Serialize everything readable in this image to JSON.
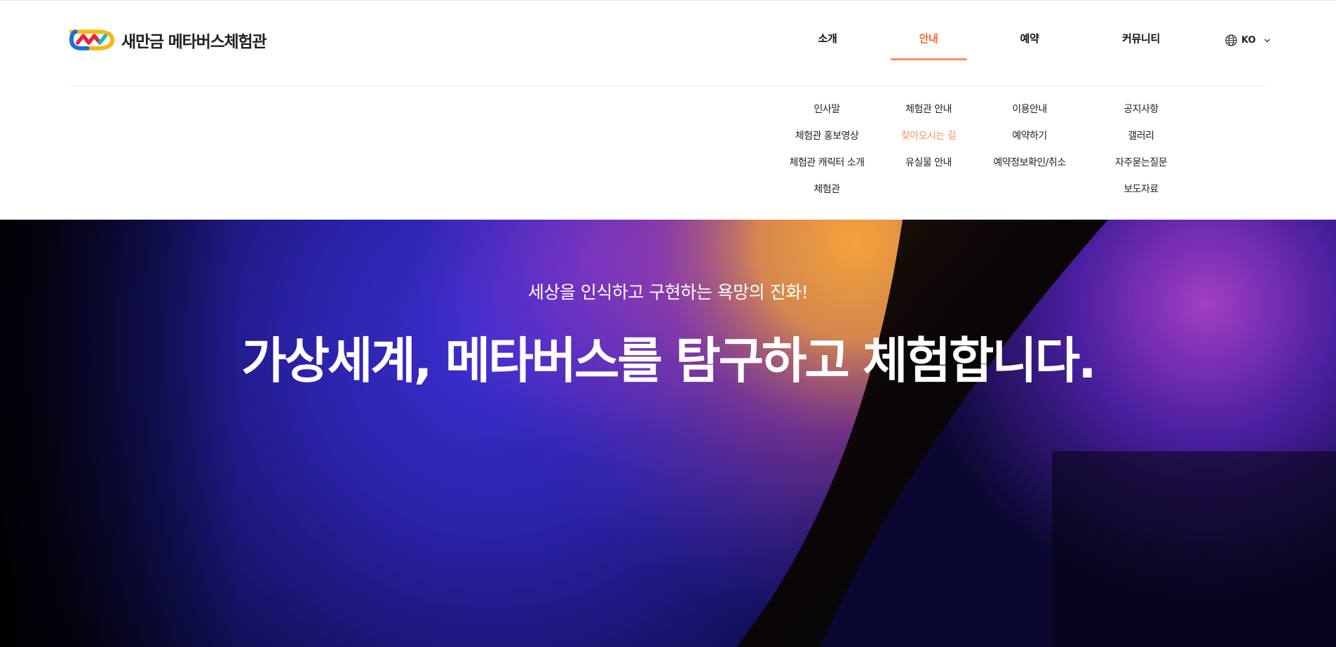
{
  "brand": {
    "logo_text": "새만금 메타버스체험관",
    "colors": {
      "accent": "#f26a2e",
      "accent_light": "#f7905d",
      "logo_blue": "#1b6fd6",
      "logo_teal": "#19b9c9",
      "logo_red": "#e8223e",
      "logo_yellow": "#f6b818"
    }
  },
  "gnb": {
    "items": [
      {
        "label": "소개"
      },
      {
        "label": "안내"
      },
      {
        "label": "예약"
      },
      {
        "label": "커뮤니티"
      }
    ],
    "active_index": 1
  },
  "lang": {
    "label": "KO",
    "icon": "globe-icon",
    "chevron": "chevron-down-icon"
  },
  "submenu": {
    "columns": [
      {
        "items": [
          "인사말",
          "체험관 홍보영상",
          "체험관 캐릭터 소개",
          "체험관"
        ]
      },
      {
        "items": [
          "체험관 안내",
          "찾아오시는 길",
          "유실물 안내"
        ]
      },
      {
        "items": [
          "이용안내",
          "예약하기",
          "예약정보확인/취소"
        ]
      },
      {
        "items": [
          "공지사항",
          "갤러리",
          "자주묻는질문",
          "보도자료"
        ]
      }
    ],
    "active": "찾아오시는 길"
  },
  "hero": {
    "subtitle": "세상을 인식하고 구현하는 욕망의 진화!",
    "title": "가상세계, 메타버스를 탐구하고 체험합니다."
  }
}
